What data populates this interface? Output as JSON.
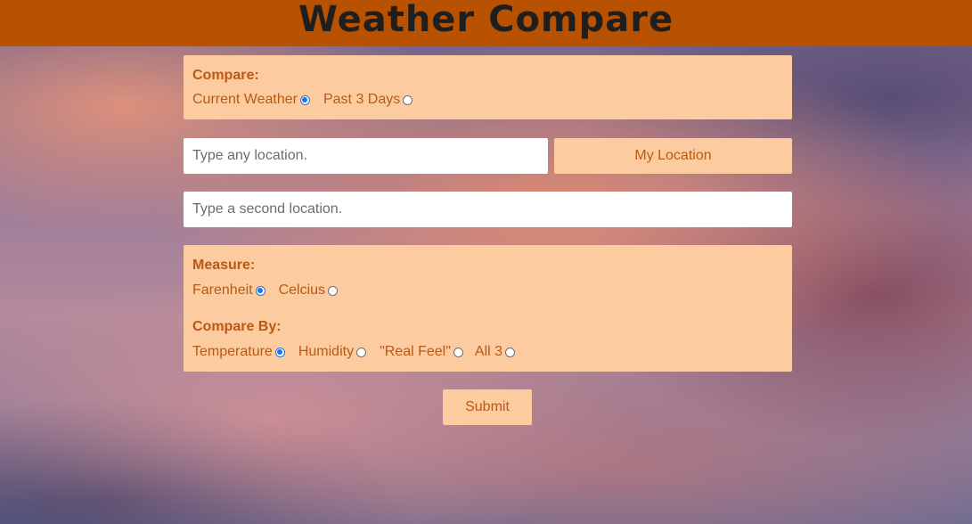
{
  "header": {
    "title": "Weather Compare"
  },
  "compare_panel": {
    "label": "Compare:",
    "options": [
      {
        "label": "Current Weather",
        "checked": true
      },
      {
        "label": "Past 3 Days",
        "checked": false
      }
    ]
  },
  "location": {
    "first_placeholder": "Type any location.",
    "first_value": "",
    "my_location_label": "My Location",
    "second_placeholder": "Type a second location.",
    "second_value": ""
  },
  "options_panel": {
    "measure_label": "Measure:",
    "measure_options": [
      {
        "label": "Farenheit",
        "checked": true
      },
      {
        "label": "Celcius",
        "checked": false
      }
    ],
    "compare_by_label": "Compare By:",
    "compare_by_options": [
      {
        "label": "Temperature",
        "checked": true
      },
      {
        "label": "Humidity",
        "checked": false
      },
      {
        "label": "\"Real Feel\"",
        "checked": false
      },
      {
        "label": "All 3",
        "checked": false
      }
    ]
  },
  "submit_label": "Submit",
  "colors": {
    "header": "#b95200",
    "panel": "#fdcba0",
    "text": "#b85a14",
    "radio_selected": "#1a73e8"
  }
}
